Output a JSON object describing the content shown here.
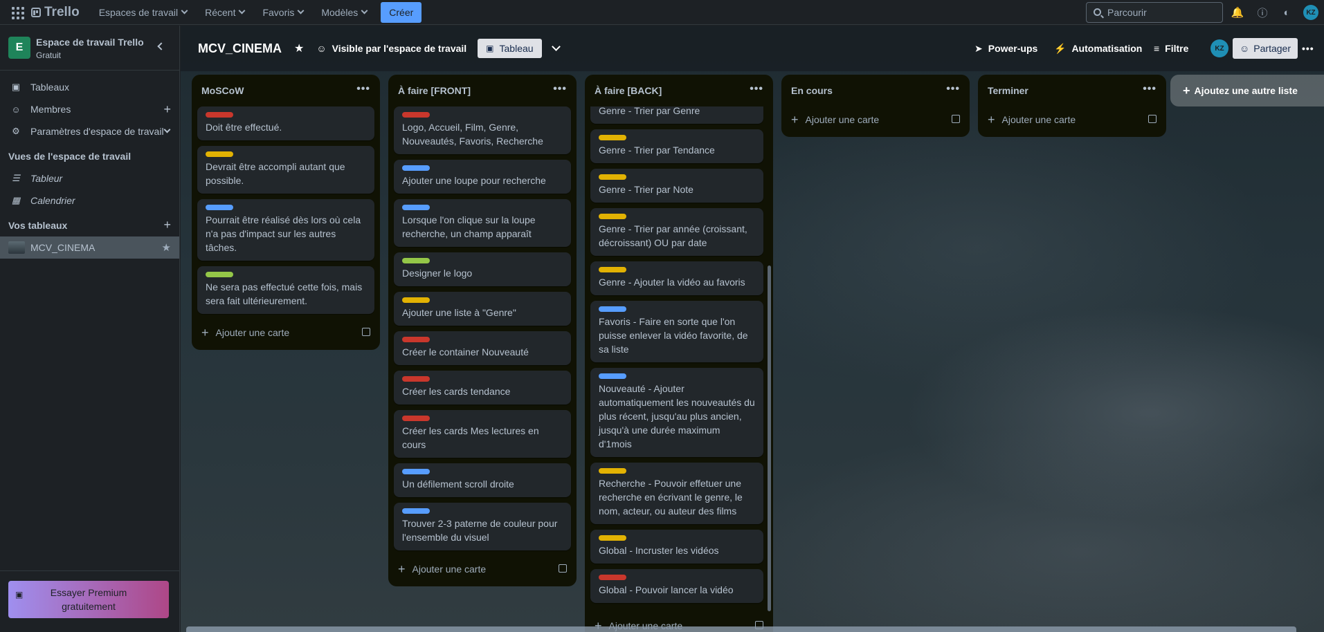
{
  "topbar": {
    "logo": "Trello",
    "menu": [
      {
        "label": "Espaces de travail"
      },
      {
        "label": "Récent"
      },
      {
        "label": "Favoris"
      },
      {
        "label": "Modèles"
      }
    ],
    "create_label": "Créer",
    "search_placeholder": "Parcourir",
    "avatar_initials": "KZ"
  },
  "sidebar": {
    "workspace_initial": "E",
    "workspace_name": "Espace de travail Trello",
    "workspace_plan": "Gratuit",
    "items": [
      {
        "label": "Tableaux",
        "icon": "board-icon"
      },
      {
        "label": "Membres",
        "icon": "person-icon"
      },
      {
        "label": "Paramètres d'espace de travail",
        "icon": "gear-icon"
      }
    ],
    "views_title": "Vues de l'espace de travail",
    "views": [
      {
        "label": "Tableur",
        "icon": "table-icon"
      },
      {
        "label": "Calendrier",
        "icon": "calendar-icon"
      }
    ],
    "boards_title": "Vos tableaux",
    "boards": [
      {
        "label": "MCV_CINEMA"
      }
    ],
    "premium_label": "Essayer Premium gratuitement"
  },
  "board": {
    "title": "MCV_CINEMA",
    "visibility": "Visible par l'espace de travail",
    "view_tab": "Tableau",
    "powerups": "Power-ups",
    "automation": "Automatisation",
    "filter": "Filtre",
    "share": "Partager",
    "add_list": "Ajoutez une autre liste",
    "add_card": "Ajouter une carte"
  },
  "colors": {
    "red": "#c9372c",
    "yellow": "#e2b203",
    "blue": "#579dff",
    "green": "#94c748"
  },
  "lists": [
    {
      "title": "MoSCoW",
      "cards": [
        {
          "label": "red",
          "text": "Doit être effectué."
        },
        {
          "label": "yellow",
          "text": "Devrait être accompli autant que possible."
        },
        {
          "label": "blue",
          "text": "Pourrait être réalisé dès lors où cela n'a pas d'impact sur les autres tâches."
        },
        {
          "label": "green",
          "text": "Ne sera pas effectué cette fois, mais sera fait ultérieurement."
        }
      ]
    },
    {
      "title": "À faire [FRONT]",
      "cards": [
        {
          "label": "red",
          "text": "Logo, Accueil, Film, Genre, Nouveautés, Favoris, Recherche"
        },
        {
          "label": "blue",
          "text": "Ajouter une loupe pour recherche"
        },
        {
          "label": "blue",
          "text": "Lorsque l'on clique sur la loupe recherche, un champ apparaît"
        },
        {
          "label": "green",
          "text": "Designer le logo"
        },
        {
          "label": "yellow",
          "text": "Ajouter une liste à \"Genre\""
        },
        {
          "label": "red",
          "text": "Créer le container Nouveauté"
        },
        {
          "label": "red",
          "text": "Créer les cards tendance"
        },
        {
          "label": "red",
          "text": "Créer les cards Mes lectures en cours"
        },
        {
          "label": "blue",
          "text": "Un défilement scroll droite"
        },
        {
          "label": "blue",
          "text": "Trouver 2-3 paterne de couleur pour l'ensemble du visuel"
        }
      ]
    },
    {
      "title": "À faire [BACK]",
      "cards": [
        {
          "label": "",
          "text": "Genre - Trier par Genre"
        },
        {
          "label": "yellow",
          "text": "Genre - Trier par Tendance"
        },
        {
          "label": "yellow",
          "text": "Genre - Trier par Note"
        },
        {
          "label": "yellow",
          "text": "Genre - Trier par année (croissant, décroissant) OU par date"
        },
        {
          "label": "yellow",
          "text": "Genre - Ajouter la vidéo au favoris"
        },
        {
          "label": "blue",
          "text": "Favoris - Faire en sorte que l'on puisse enlever la vidéo favorite, de sa liste"
        },
        {
          "label": "blue",
          "text": "Nouveauté - Ajouter automatiquement les nouveautés du plus récent, jusqu'au plus ancien, jusqu'à une durée maximum d'1mois"
        },
        {
          "label": "yellow",
          "text": "Recherche - Pouvoir effetuer une recherche en écrivant le genre, le nom, acteur, ou auteur des films"
        },
        {
          "label": "yellow",
          "text": "Global - Incruster les vidéos"
        },
        {
          "label": "red",
          "text": "Global - Pouvoir lancer la vidéo"
        }
      ]
    },
    {
      "title": "En cours",
      "cards": []
    },
    {
      "title": "Terminer",
      "cards": []
    }
  ]
}
